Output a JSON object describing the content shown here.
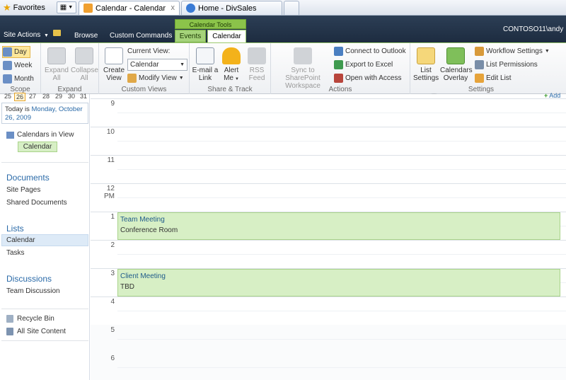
{
  "browser": {
    "favorites": "Favorites",
    "tabs": [
      {
        "label": "Calendar - Calendar",
        "close": "x"
      },
      {
        "label": "Home - DivSales"
      }
    ]
  },
  "sharepoint": {
    "site_actions": "Site Actions",
    "tabs": {
      "browse": "Browse",
      "custom_commands": "Custom Commands",
      "events": "Events",
      "calendar": "Calendar"
    },
    "context_group": "Calendar Tools",
    "user": "CONTOSO11\\andy"
  },
  "ribbon": {
    "scope": {
      "label": "Scope",
      "day": "Day",
      "week": "Week",
      "month": "Month"
    },
    "expand": {
      "label": "Expand",
      "expand_all": [
        "Expand",
        "All"
      ],
      "collapse_all": [
        "Collapse",
        "All"
      ]
    },
    "custom_views": {
      "label": "Custom Views",
      "create_view": [
        "Create",
        "View"
      ],
      "current_view_label": "Current View:",
      "current_view_value": "Calendar",
      "modify_view": "Modify View"
    },
    "share_track": {
      "label": "Share & Track",
      "email_link": [
        "E-mail a",
        "Link"
      ],
      "alert_me": [
        "Alert",
        "Me"
      ],
      "rss_feed": [
        "RSS",
        "Feed"
      ]
    },
    "actions": {
      "label": "Actions",
      "sync": [
        "Sync to SharePoint",
        "Workspace"
      ],
      "connect_outlook": "Connect to Outlook",
      "export_excel": "Export to Excel",
      "open_access": "Open with Access"
    },
    "settings": {
      "label": "Settings",
      "list_settings": [
        "List",
        "Settings"
      ],
      "calendars_overlay": [
        "Calendars",
        "Overlay"
      ],
      "workflow_settings": "Workflow Settings",
      "list_permissions": "List Permissions",
      "edit_list": "Edit List"
    }
  },
  "leftnav": {
    "mini_days": [
      "25",
      "26",
      "27",
      "28",
      "29",
      "30",
      "31"
    ],
    "today_prefix": "Today is ",
    "today_date": "Monday, October 26, 2009",
    "calendars_in_view": "Calendars in View",
    "calendar_tag": "Calendar",
    "documents": {
      "heading": "Documents",
      "items": [
        "Site Pages",
        "Shared Documents"
      ]
    },
    "lists": {
      "heading": "Lists",
      "items": [
        "Calendar",
        "Tasks"
      ]
    },
    "discussions": {
      "heading": "Discussions",
      "items": [
        "Team Discussion"
      ]
    },
    "recycle_bin": "Recycle Bin",
    "all_site_content": "All Site Content"
  },
  "calendar": {
    "add_label": "Add",
    "hours": [
      "9",
      "10",
      "11",
      "12 PM",
      "1",
      "2",
      "3",
      "4",
      "5",
      "6"
    ],
    "events": [
      {
        "title": "Team Meeting",
        "location": "Conference Room",
        "hour": "1"
      },
      {
        "title": "Client Meeting",
        "location": "TBD",
        "hour": "3"
      }
    ]
  },
  "colors": {
    "accent_green": "#8bc34a",
    "nav_blue": "#2a6aa8",
    "event_fill": "#d7efc5",
    "topbar": "#1d2c40"
  }
}
